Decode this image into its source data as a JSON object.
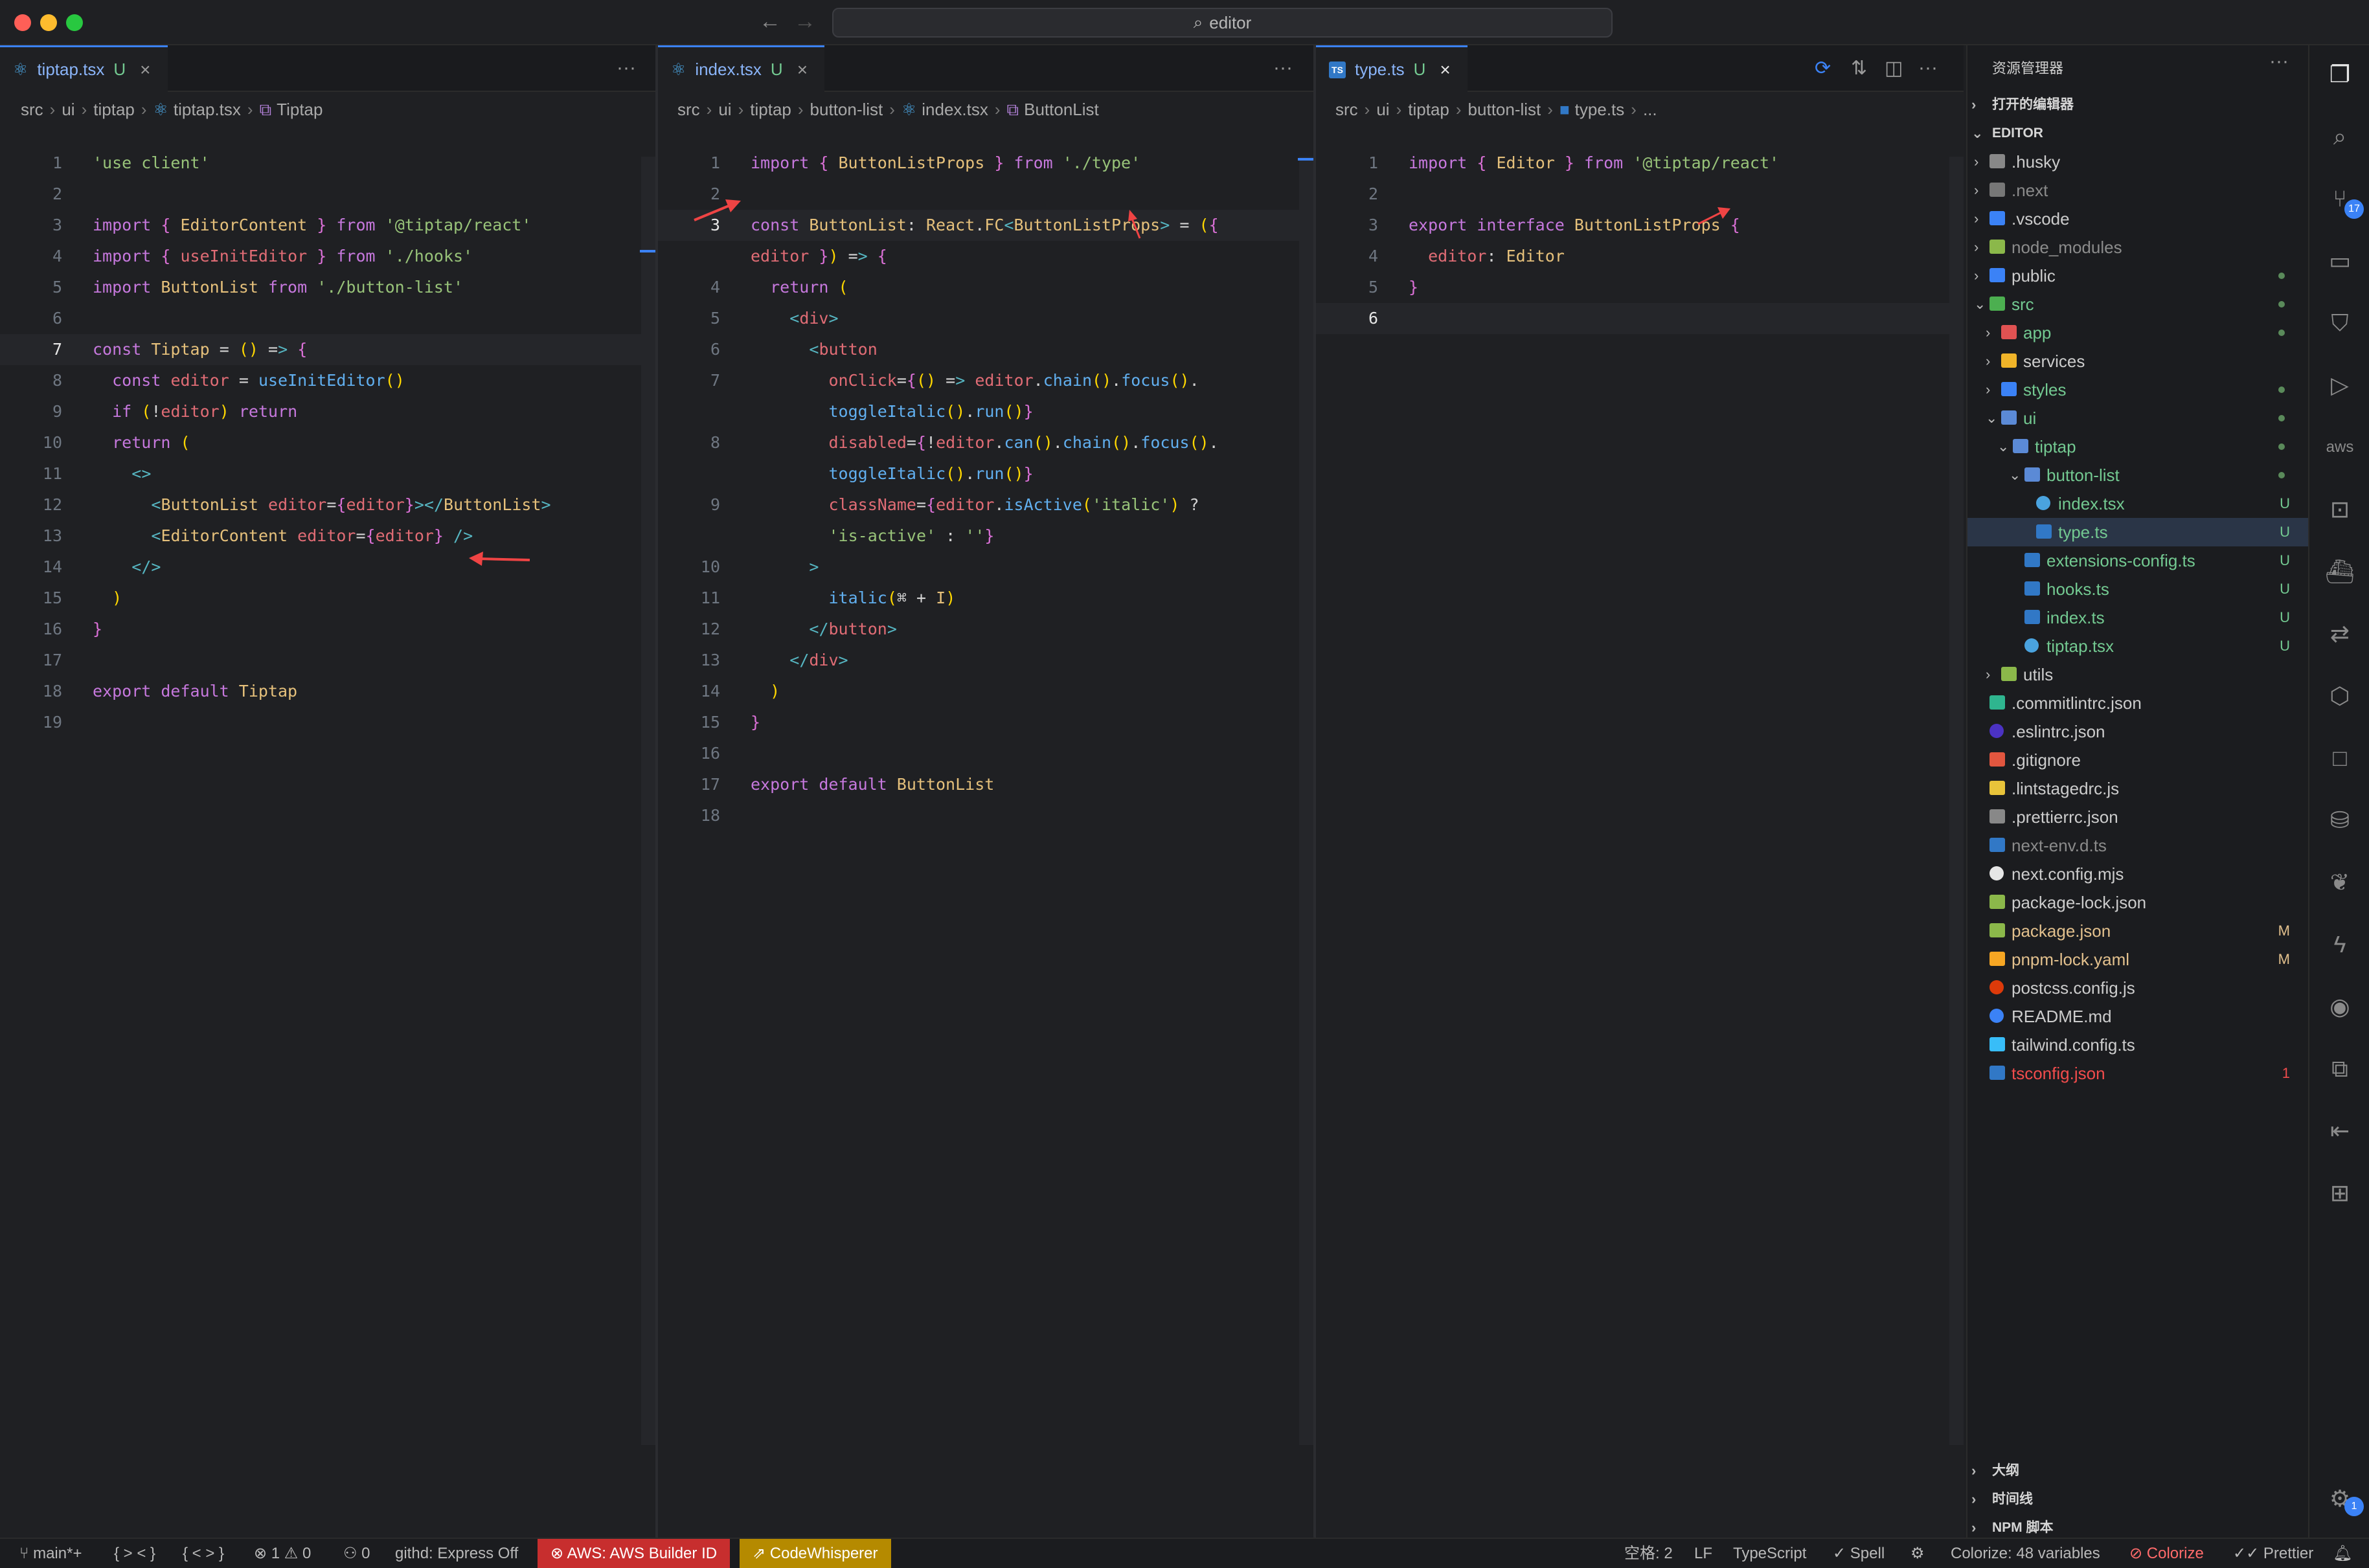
{
  "titlebar": {
    "back_glyph": "←",
    "forward_glyph": "→",
    "search_text": "editor",
    "search_icon": "search-icon"
  },
  "colors": {
    "accent": "#3b82f6",
    "untracked_green": "#73c991",
    "error_red": "#f14c4c",
    "status_aws_bg": "#c72e2e",
    "status_cw_bg": "#b58a00"
  },
  "editors": [
    {
      "tab": {
        "label": "tiptap.tsx",
        "status": "U",
        "close": "×",
        "more": "···",
        "icon": "react-icon"
      },
      "breadcrumb": [
        "src",
        "ui",
        "tiptap",
        "tiptap.tsx",
        "Tiptap"
      ],
      "lines": [
        {
          "n": "1",
          "t": "'use client'"
        },
        {
          "n": "2",
          "t": ""
        },
        {
          "n": "3",
          "t": "import { EditorContent } from '@tiptap/react'"
        },
        {
          "n": "4",
          "t": "import { useInitEditor } from './hooks'"
        },
        {
          "n": "5",
          "t": "import ButtonList from './button-list'"
        },
        {
          "n": "6",
          "t": ""
        },
        {
          "n": "7",
          "t": "const Tiptap = () => {"
        },
        {
          "n": "8",
          "t": "  const editor = useInitEditor()"
        },
        {
          "n": "9",
          "t": "  if (!editor) return"
        },
        {
          "n": "10",
          "t": "  return ("
        },
        {
          "n": "11",
          "t": "    <>"
        },
        {
          "n": "12",
          "t": "      <ButtonList editor={editor}></ButtonList>"
        },
        {
          "n": "13",
          "t": "      <EditorContent editor={editor} />"
        },
        {
          "n": "14",
          "t": "    </>"
        },
        {
          "n": "15",
          "t": "  )"
        },
        {
          "n": "16",
          "t": "}"
        },
        {
          "n": "17",
          "t": ""
        },
        {
          "n": "18",
          "t": "export default Tiptap"
        },
        {
          "n": "19",
          "t": ""
        }
      ]
    },
    {
      "tab": {
        "label": "index.tsx",
        "status": "U",
        "close": "×",
        "more": "···",
        "icon": "react-icon"
      },
      "breadcrumb": [
        "src",
        "ui",
        "tiptap",
        "button-list",
        "index.tsx",
        "ButtonList"
      ],
      "lines": [
        {
          "n": "1",
          "t": "import { ButtonListProps } from './type'"
        },
        {
          "n": "2",
          "t": ""
        },
        {
          "n": "3",
          "t": "const ButtonList: React.FC<ButtonListProps> = ({"
        },
        {
          "n": "",
          "t": "editor }) => {"
        },
        {
          "n": "4",
          "t": "  return ("
        },
        {
          "n": "5",
          "t": "    <div>"
        },
        {
          "n": "6",
          "t": "      <button"
        },
        {
          "n": "7",
          "t": "        onClick={() => editor.chain().focus()."
        },
        {
          "n": "",
          "t": "        toggleItalic().run()}"
        },
        {
          "n": "8",
          "t": "        disabled={!editor.can().chain().focus()."
        },
        {
          "n": "",
          "t": "        toggleItalic().run()}"
        },
        {
          "n": "9",
          "t": "        className={editor.isActive('italic') ?"
        },
        {
          "n": "",
          "t": "        'is-active' : ''}"
        },
        {
          "n": "10",
          "t": "      >"
        },
        {
          "n": "11",
          "t": "        italic(⌘ + I)"
        },
        {
          "n": "12",
          "t": "      </button>"
        },
        {
          "n": "13",
          "t": "    </div>"
        },
        {
          "n": "14",
          "t": "  )"
        },
        {
          "n": "15",
          "t": "}"
        },
        {
          "n": "16",
          "t": ""
        },
        {
          "n": "17",
          "t": "export default ButtonList"
        },
        {
          "n": "18",
          "t": ""
        }
      ]
    },
    {
      "tab": {
        "label": "type.ts",
        "status": "U",
        "close": "×",
        "more": "···",
        "icon": "ts-icon",
        "icon_text": "TS"
      },
      "breadcrumb": [
        "src",
        "ui",
        "tiptap",
        "button-list",
        "type.ts",
        "..."
      ],
      "lines": [
        {
          "n": "1",
          "t": "import { Editor } from '@tiptap/react'"
        },
        {
          "n": "2",
          "t": ""
        },
        {
          "n": "3",
          "t": "export interface ButtonListProps {"
        },
        {
          "n": "4",
          "t": "  editor: Editor"
        },
        {
          "n": "5",
          "t": "}"
        },
        {
          "n": "6",
          "t": ""
        }
      ]
    }
  ],
  "explorer": {
    "title": "资源管理器",
    "more": "···",
    "open_editors": "打开的编辑器",
    "root": "EDITOR",
    "items": [
      {
        "name": ".husky",
        "depth": 1,
        "kind": "folder",
        "chev": "›"
      },
      {
        "name": ".next",
        "depth": 1,
        "kind": "folder",
        "chev": "›",
        "dim": true
      },
      {
        "name": ".vscode",
        "depth": 1,
        "kind": "folder",
        "chev": "›"
      },
      {
        "name": "node_modules",
        "depth": 1,
        "kind": "folder",
        "chev": "›",
        "dim": true
      },
      {
        "name": "public",
        "depth": 1,
        "kind": "folder",
        "chev": "›",
        "dot": true
      },
      {
        "name": "src",
        "depth": 1,
        "kind": "folder",
        "chev": "⌄",
        "green": true,
        "dot": true
      },
      {
        "name": "app",
        "depth": 2,
        "kind": "folder",
        "chev": "›",
        "green": true,
        "dot": true
      },
      {
        "name": "services",
        "depth": 2,
        "kind": "folder",
        "chev": "›"
      },
      {
        "name": "styles",
        "depth": 2,
        "kind": "folder",
        "chev": "›",
        "green": true,
        "dot": true
      },
      {
        "name": "ui",
        "depth": 2,
        "kind": "folder",
        "chev": "⌄",
        "green": true,
        "dot": true
      },
      {
        "name": "tiptap",
        "depth": 3,
        "kind": "folder",
        "chev": "⌄",
        "green": true,
        "dot": true
      },
      {
        "name": "button-list",
        "depth": 4,
        "kind": "folder",
        "chev": "⌄",
        "green": true,
        "dot": true
      },
      {
        "name": "index.tsx",
        "depth": 5,
        "kind": "react",
        "badge": "U",
        "green": true
      },
      {
        "name": "type.ts",
        "depth": 5,
        "kind": "ts",
        "badge": "U",
        "green": true,
        "selected": true
      },
      {
        "name": "extensions-config.ts",
        "depth": 4,
        "kind": "ts",
        "badge": "U",
        "green": true
      },
      {
        "name": "hooks.ts",
        "depth": 4,
        "kind": "ts",
        "badge": "U",
        "green": true
      },
      {
        "name": "index.ts",
        "depth": 4,
        "kind": "ts",
        "badge": "U",
        "green": true
      },
      {
        "name": "tiptap.tsx",
        "depth": 4,
        "kind": "react",
        "badge": "U",
        "green": true
      },
      {
        "name": "utils",
        "depth": 2,
        "kind": "folder",
        "chev": "›"
      },
      {
        "name": ".commitlintrc.json",
        "depth": 1,
        "kind": "config"
      },
      {
        "name": ".eslintrc.json",
        "depth": 1,
        "kind": "eslint"
      },
      {
        "name": ".gitignore",
        "depth": 1,
        "kind": "git"
      },
      {
        "name": ".lintstagedrc.js",
        "depth": 1,
        "kind": "js"
      },
      {
        "name": ".prettierrc.json",
        "depth": 1,
        "kind": "prettier"
      },
      {
        "name": "next-env.d.ts",
        "depth": 1,
        "kind": "ts",
        "dim": true
      },
      {
        "name": "next.config.mjs",
        "depth": 1,
        "kind": "next"
      },
      {
        "name": "package-lock.json",
        "depth": 1,
        "kind": "npm"
      },
      {
        "name": "package.json",
        "depth": 1,
        "kind": "npm",
        "badge": "M",
        "yellow": true
      },
      {
        "name": "pnpm-lock.yaml",
        "depth": 1,
        "kind": "pnpm",
        "badge": "M",
        "yellow": true
      },
      {
        "name": "postcss.config.js",
        "depth": 1,
        "kind": "postcss"
      },
      {
        "name": "README.md",
        "depth": 1,
        "kind": "info"
      },
      {
        "name": "tailwind.config.ts",
        "depth": 1,
        "kind": "tailwind"
      },
      {
        "name": "tsconfig.json",
        "depth": 1,
        "kind": "ts",
        "badge": "1",
        "red": true
      }
    ],
    "bottom_sections": [
      "大纲",
      "时间线",
      "NPM 脚本"
    ]
  },
  "activity_bar": {
    "items": [
      {
        "icon": "explorer-icon",
        "glyph": "❐",
        "active": true
      },
      {
        "icon": "search-icon",
        "glyph": "⌕"
      },
      {
        "icon": "source-control-icon",
        "glyph": "⑂",
        "badge": "17"
      },
      {
        "icon": "folder-icon",
        "glyph": "▭"
      },
      {
        "icon": "bookmark-icon",
        "glyph": "⛉"
      },
      {
        "icon": "run-debug-icon",
        "glyph": "▷"
      },
      {
        "icon": "aws-icon",
        "glyph": "aws"
      },
      {
        "icon": "remote-explorer-icon",
        "glyph": "⊡"
      },
      {
        "icon": "docker-icon",
        "glyph": "⛴"
      },
      {
        "icon": "sync-icon",
        "glyph": "⇄"
      },
      {
        "icon": "extension-hex-icon",
        "glyph": "⬡"
      },
      {
        "icon": "square-icon",
        "glyph": "□"
      },
      {
        "icon": "database-icon",
        "glyph": "⛁"
      },
      {
        "icon": "leaf-icon",
        "glyph": "❦"
      },
      {
        "icon": "lightning-icon",
        "glyph": "ϟ"
      },
      {
        "icon": "github-icon",
        "glyph": "◉"
      },
      {
        "icon": "diagram-icon",
        "glyph": "⧉"
      },
      {
        "icon": "git-graph-icon",
        "glyph": "⇤"
      },
      {
        "icon": "extensions-icon",
        "glyph": "⊞"
      }
    ],
    "settings_icon": "gear-icon",
    "settings_glyph": "⚙",
    "settings_badge": "1"
  },
  "statusbar": {
    "branch": "main*+",
    "braces1": "{ > < }",
    "braces2": "{ < > }",
    "problems": "⊗ 1 ⚠ 0",
    "ports": "⚇ 0",
    "githd": "githd: Express Off",
    "aws": "⊗ AWS: AWS Builder ID",
    "codewhisperer": "⇗ CodeWhisperer",
    "spaces": "空格: 2",
    "eol": "LF",
    "language": "TypeScript",
    "spell": "✓ Spell",
    "colorize_vars": "Colorize: 48 variables",
    "colorize": "⊘ Colorize",
    "prettier": "✓✓ Prettier",
    "bell": "🔔︎"
  }
}
